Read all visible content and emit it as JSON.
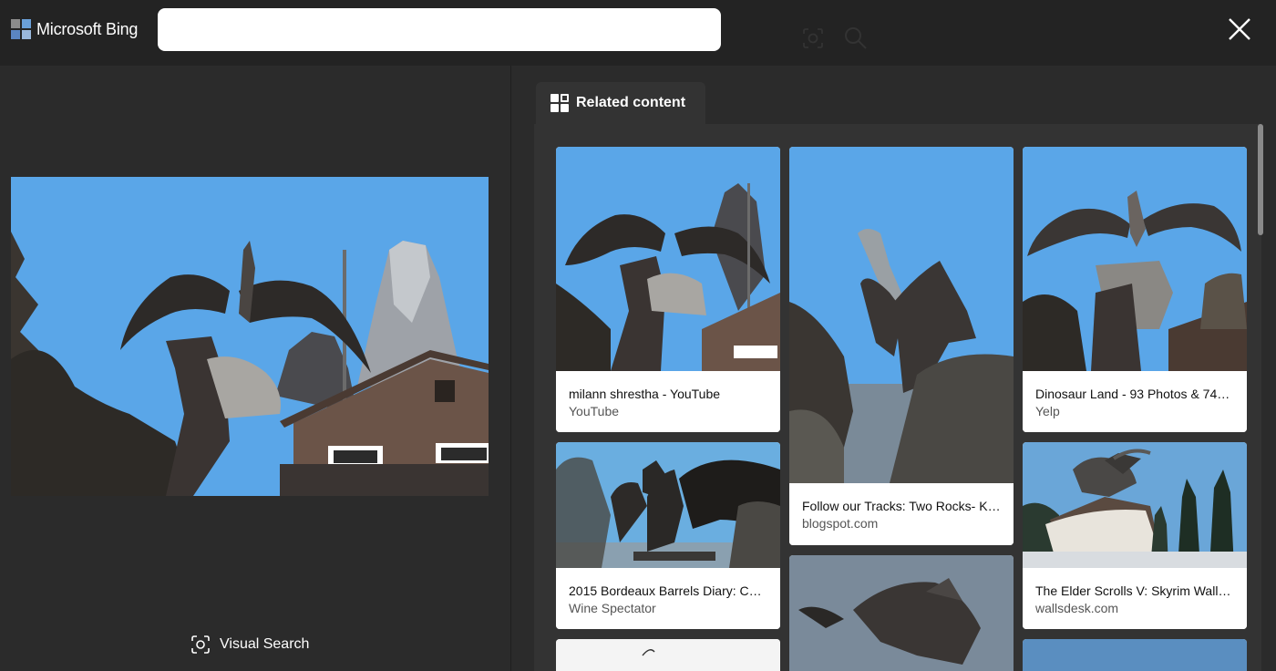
{
  "header": {
    "brand": "Microsoft Bing",
    "search_placeholder": "",
    "icons": [
      "visual-search-icon",
      "search-icon",
      "close-icon"
    ]
  },
  "left_panel": {
    "visual_search_label": "Visual Search"
  },
  "right_panel": {
    "tab_label": "Related content",
    "cards": [
      {
        "title": "milann shrestha - YouTube",
        "source": "YouTube"
      },
      {
        "title": "Follow our Tracks: Two Rocks- K…",
        "source": "blogspot.com"
      },
      {
        "title": "Dinosaur Land - 93 Photos & 74…",
        "source": "Yelp"
      },
      {
        "title": "2015 Bordeaux Barrels Diary: Ch…",
        "source": "Wine Spectator"
      },
      {
        "title": "The Elder Scrolls V: Skyrim Wall…",
        "source": "wallsdesk.com"
      }
    ]
  },
  "colors": {
    "background": "#2b2b2b",
    "header": "#232323",
    "sky": "#5aa6e8"
  }
}
